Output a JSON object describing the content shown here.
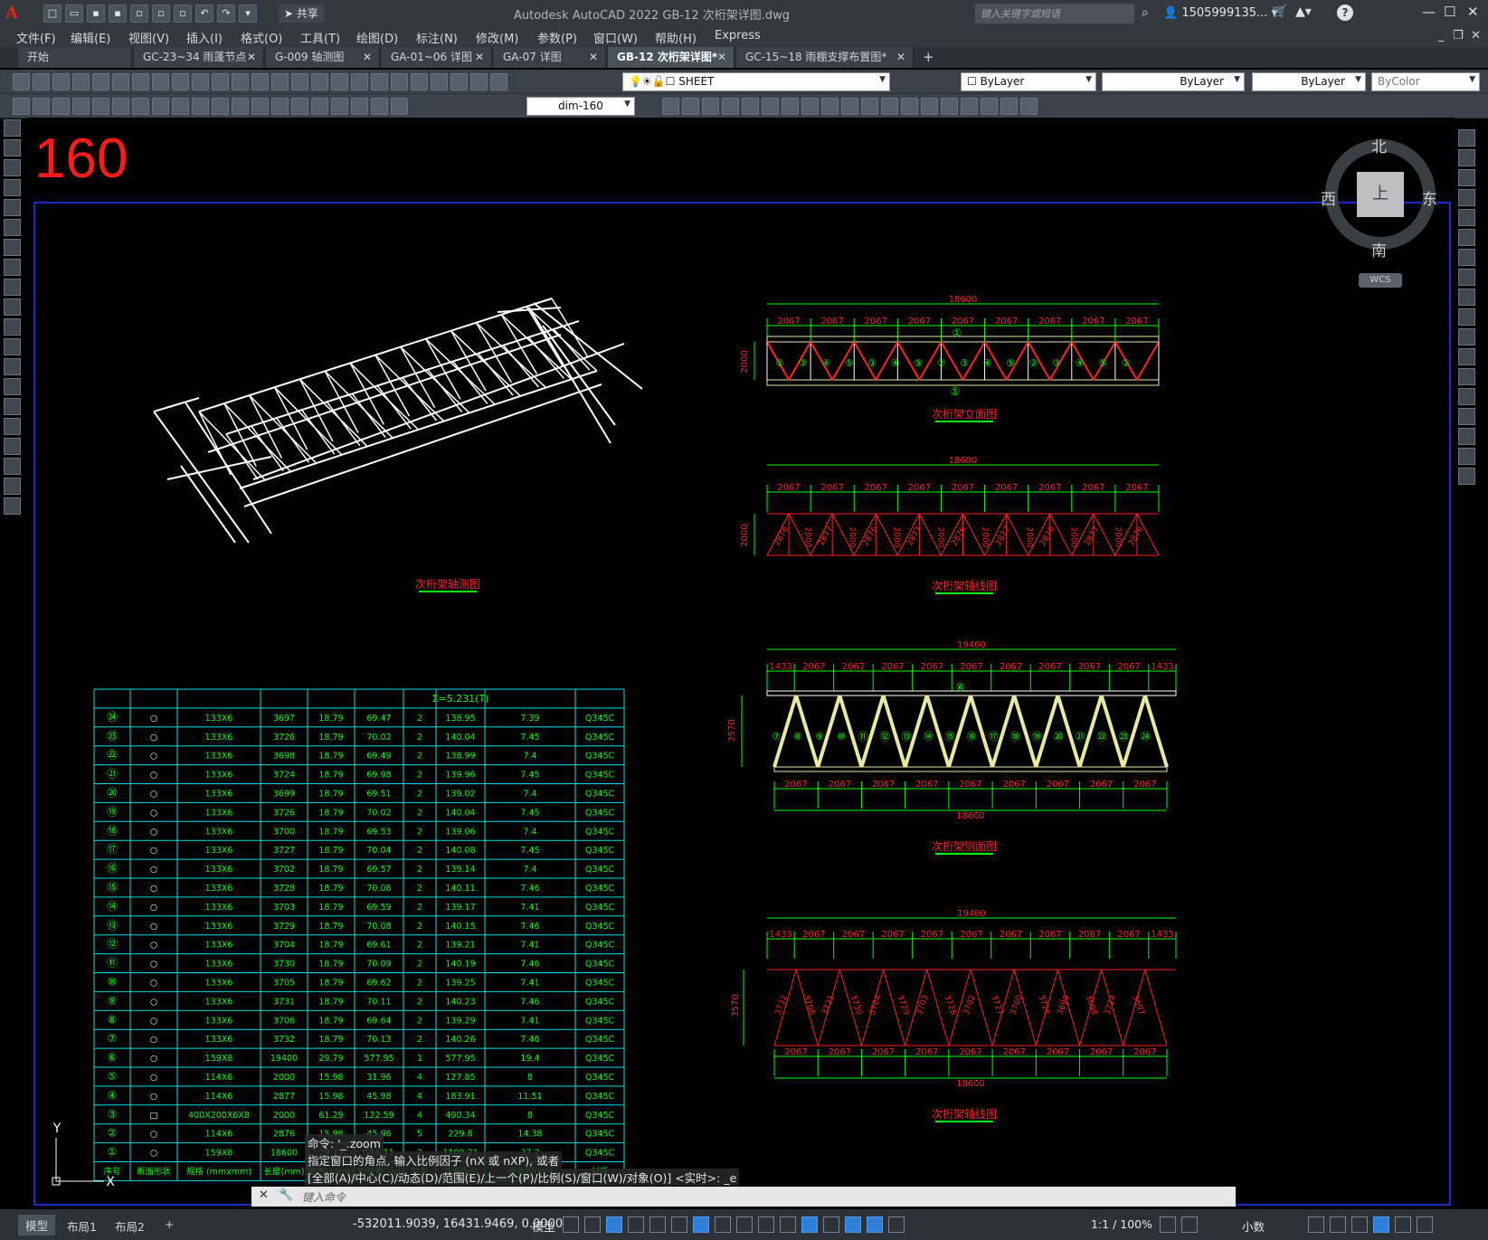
{
  "window": {
    "title": "Autodesk AutoCAD 2022    GB-12 次桁架详图.dwg",
    "share_label": "共享",
    "search_placeholder": "键入关键字或短语",
    "user": "1505999135...",
    "help": "?"
  },
  "menu": [
    "文件(F)",
    "编辑(E)",
    "视图(V)",
    "插入(I)",
    "格式(O)",
    "工具(T)",
    "绘图(D)",
    "标注(N)",
    "修改(M)",
    "参数(P)",
    "窗口(W)",
    "帮助(H)",
    "Express"
  ],
  "tabs": [
    {
      "label": "开始",
      "active": false,
      "close": false
    },
    {
      "label": "GC-23~34 雨蓬节点",
      "active": false,
      "close": true
    },
    {
      "label": "G-009 轴测图",
      "active": false,
      "close": true
    },
    {
      "label": "GA-01~06 详图",
      "active": false,
      "close": true
    },
    {
      "label": "GA-07 详图",
      "active": false,
      "close": true
    },
    {
      "label": "GB-12 次桁架详图*",
      "active": true,
      "close": true
    },
    {
      "label": "GC-15~18 雨棚支撑布置图*",
      "active": false,
      "close": true
    }
  ],
  "toolbar": {
    "layer_name": "SHEET",
    "color": "ByLayer",
    "linetype": "ByLayer",
    "lineweight": "ByLayer",
    "plotstyle": "ByColor",
    "dimstyle": "dim-160"
  },
  "canvas": {
    "sheet_number": "160",
    "viewcube": {
      "north": "北",
      "south": "南",
      "west": "西",
      "east": "东",
      "top": "上",
      "wcs": "WCS"
    },
    "ucs_y": "Y",
    "ucs_x": "X",
    "titles": {
      "iso": "次桁架轴测图",
      "elev": "次桁架立面图",
      "axis1": "次桁架轴线图",
      "side": "次桁架侧面图",
      "axis2": "次桁架轴线图"
    },
    "elev": {
      "total": "18600",
      "spans": [
        "2067",
        "2067",
        "2067",
        "2067",
        "2067",
        "2067",
        "2067",
        "2067",
        "2067"
      ],
      "height": "2000",
      "top_mark": "①",
      "bottom_mark": "①",
      "members": [
        "②",
        "③",
        "④",
        "⑤",
        "③",
        "④",
        "⑤",
        "②",
        "③",
        "④",
        "⑤",
        "②",
        "③",
        "④",
        "⑤",
        "②"
      ]
    },
    "axis1": {
      "total": "18600",
      "spans": [
        "2067",
        "2067",
        "2067",
        "2067",
        "2067",
        "2067",
        "2067",
        "2067",
        "2067"
      ],
      "height": "2000",
      "diagonals": [
        "2876",
        "2000",
        "2877",
        "2000",
        "2876",
        "2000",
        "2877",
        "2000",
        "2876",
        "2000",
        "2877",
        "2000",
        "2876",
        "2000",
        "2877",
        "2000",
        "2876"
      ]
    },
    "side": {
      "total_top": "19400",
      "spans_top": [
        "1433",
        "2067",
        "2067",
        "2067",
        "2067",
        "2067",
        "2067",
        "2067",
        "2067",
        "2067",
        "1433"
      ],
      "spans_bottom": [
        "2067",
        "2067",
        "2067",
        "2067",
        "2067",
        "2067",
        "2067",
        "2067",
        "2067"
      ],
      "total_bottom": "18600",
      "height": "3570",
      "top_mark": "⑥",
      "members": [
        "⑦",
        "⑧",
        "⑨",
        "⑩",
        "⑪",
        "⑫",
        "⑬",
        "⑭",
        "⑮",
        "⑯",
        "⑰",
        "⑱",
        "⑲",
        "⑳",
        "㉑",
        "㉒",
        "㉓",
        "㉔"
      ]
    },
    "axis2": {
      "total_top": "19400",
      "spans_top": [
        "1433",
        "2067",
        "2067",
        "2067",
        "2067",
        "2067",
        "2067",
        "2067",
        "2067",
        "2067",
        "1433"
      ],
      "spans_bottom": [
        "2067",
        "2067",
        "2067",
        "2067",
        "2067",
        "2067",
        "2067",
        "2067",
        "2067"
      ],
      "total_bottom": "18600",
      "height": "3570",
      "diagonals": [
        "3732",
        "3706",
        "3731",
        "3730",
        "3704",
        "3729",
        "3703",
        "3728",
        "3702",
        "3727",
        "3700",
        "3726",
        "3699",
        "3698",
        "3724",
        "3697"
      ]
    },
    "table": {
      "total": "Σ=5.231(T)",
      "header": [
        "序号",
        "断面形状",
        "规格 (mmxmm)",
        "长度(mm)",
        "单重(kg/m)",
        "构件重(kg)",
        "数量",
        "总重(kg)",
        "表面积(m²)",
        "材质"
      ],
      "rows": [
        [
          "㉔",
          "○",
          "133X6",
          "3697",
          "18.79",
          "69.47",
          "2",
          "138.95",
          "7.39",
          "Q345C"
        ],
        [
          "㉓",
          "○",
          "133X6",
          "3726",
          "18.79",
          "70.02",
          "2",
          "140.04",
          "7.45",
          "Q345C"
        ],
        [
          "㉒",
          "○",
          "133X6",
          "3698",
          "18.79",
          "69.49",
          "2",
          "138.99",
          "7.4",
          "Q345C"
        ],
        [
          "㉑",
          "○",
          "133X6",
          "3724",
          "18.79",
          "69.98",
          "2",
          "139.96",
          "7.45",
          "Q345C"
        ],
        [
          "⑳",
          "○",
          "133X6",
          "3699",
          "18.79",
          "69.51",
          "2",
          "139.02",
          "7.4",
          "Q345C"
        ],
        [
          "⑲",
          "○",
          "133X6",
          "3726",
          "18.79",
          "70.02",
          "2",
          "140.04",
          "7.45",
          "Q345C"
        ],
        [
          "⑱",
          "○",
          "133X6",
          "3700",
          "18.79",
          "69.53",
          "2",
          "139.06",
          "7.4",
          "Q345C"
        ],
        [
          "⑰",
          "○",
          "133X6",
          "3727",
          "18.79",
          "70.04",
          "2",
          "140.08",
          "7.45",
          "Q345C"
        ],
        [
          "⑯",
          "○",
          "133X6",
          "3702",
          "18.79",
          "69.57",
          "2",
          "139.14",
          "7.4",
          "Q345C"
        ],
        [
          "⑮",
          "○",
          "133X6",
          "3728",
          "18.79",
          "70.06",
          "2",
          "140.11",
          "7.46",
          "Q345C"
        ],
        [
          "⑭",
          "○",
          "133X6",
          "3703",
          "18.79",
          "69.59",
          "2",
          "139.17",
          "7.41",
          "Q345C"
        ],
        [
          "⑬",
          "○",
          "133X6",
          "3729",
          "18.79",
          "70.08",
          "2",
          "140.15",
          "7.46",
          "Q345C"
        ],
        [
          "⑫",
          "○",
          "133X6",
          "3704",
          "18.79",
          "69.61",
          "2",
          "139.21",
          "7.41",
          "Q345C"
        ],
        [
          "⑪",
          "○",
          "133X6",
          "3730",
          "18.79",
          "70.09",
          "2",
          "140.19",
          "7.46",
          "Q345C"
        ],
        [
          "⑩",
          "○",
          "133X6",
          "3705",
          "18.79",
          "69.62",
          "2",
          "139.25",
          "7.41",
          "Q345C"
        ],
        [
          "⑨",
          "○",
          "133X6",
          "3731",
          "18.79",
          "70.11",
          "2",
          "140.23",
          "7.46",
          "Q345C"
        ],
        [
          "⑧",
          "○",
          "133X6",
          "3706",
          "18.79",
          "69.64",
          "2",
          "139.29",
          "7.41",
          "Q345C"
        ],
        [
          "⑦",
          "○",
          "133X6",
          "3732",
          "18.79",
          "70.13",
          "2",
          "140.26",
          "7.46",
          "Q345C"
        ],
        [
          "⑥",
          "○",
          "159X8",
          "19400",
          "29.79",
          "577.95",
          "1",
          "577.95",
          "19.4",
          "Q345C"
        ],
        [
          "⑤",
          "○",
          "114X6",
          "2000",
          "15.98",
          "31.96",
          "4",
          "127.85",
          "8",
          "Q345C"
        ],
        [
          "④",
          "○",
          "114X6",
          "2877",
          "15.98",
          "45.98",
          "4",
          "183.91",
          "11.51",
          "Q345C"
        ],
        [
          "③",
          "□",
          "400X200X6X8",
          "2000",
          "61.29",
          "122.59",
          "4",
          "490.34",
          "8",
          "Q345C"
        ],
        [
          "②",
          "○",
          "114X6",
          "2876",
          "15.98",
          "45.96",
          "5",
          "229.8",
          "14.38",
          "Q345C"
        ],
        [
          "①",
          "○",
          "159X8",
          "18600",
          "29.79",
          "554.11",
          "2",
          "1108.21",
          "37.2",
          "Q345C"
        ]
      ]
    }
  },
  "command": {
    "history": [
      "命令: '_.zoom",
      "指定窗口的角点, 输入比例因子 (nX 或 nXP), 或者",
      "[全部(A)/中心(C)/动态(D)/范围(E)/上一个(P)/比例(S)/窗口(W)/对象(O)] <实时>: _e"
    ],
    "prompt": "键入命令"
  },
  "status": {
    "tabs": [
      "模型",
      "布局1",
      "布局2"
    ],
    "coords": "-532011.9039, 16431.9469, 0.0000",
    "space": "模型",
    "scale": "1:1 / 100%",
    "units": "小数"
  },
  "colors": {
    "grid_cyan": "#00e0e0",
    "dim_green": "#00ff00",
    "member_red": "#ff2020",
    "truss_white": "#ffffff",
    "chord_yellow": "#e8e8a0",
    "border_blue": "#1a2bd0"
  }
}
